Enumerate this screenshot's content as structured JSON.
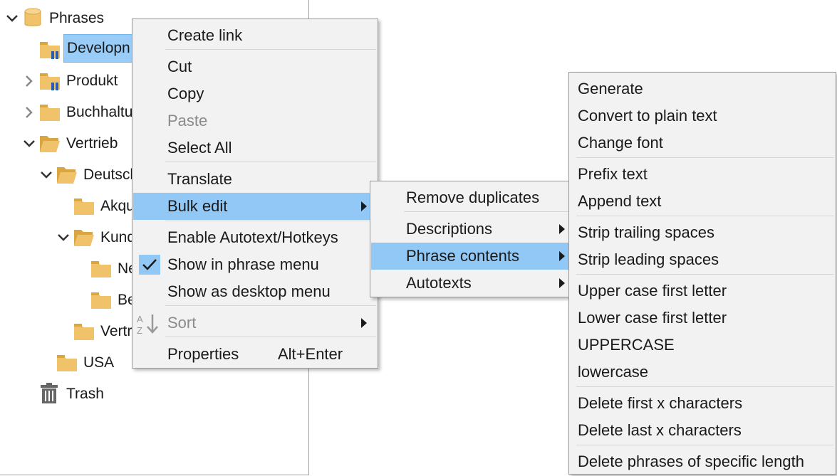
{
  "tree": {
    "items": [
      {
        "label": "Phrases",
        "icon": "database-icon"
      },
      {
        "label": "Developn",
        "icon": "folder-shared-icon"
      },
      {
        "label": "Produkt",
        "icon": "folder-shared-icon"
      },
      {
        "label": "Buchhaltu",
        "icon": "folder-icon"
      },
      {
        "label": "Vertrieb",
        "icon": "folder-open-icon"
      },
      {
        "label": "Deutsch",
        "icon": "folder-open-icon"
      },
      {
        "label": "Akqu",
        "icon": "folder-icon"
      },
      {
        "label": "Kund",
        "icon": "folder-open-icon"
      },
      {
        "label": "Ne",
        "icon": "folder-icon"
      },
      {
        "label": "Be",
        "icon": "folder-icon"
      },
      {
        "label": "Vertr",
        "icon": "folder-icon"
      },
      {
        "label": "USA",
        "icon": "folder-icon"
      },
      {
        "label": "Trash",
        "icon": "trash-icon"
      }
    ]
  },
  "context_menu": {
    "create_link": "Create link",
    "cut": "Cut",
    "copy": "Copy",
    "paste": "Paste",
    "select_all": "Select All",
    "translate": "Translate",
    "bulk_edit": "Bulk edit",
    "enable_autotext": "Enable Autotext/Hotkeys",
    "show_in_phrase_menu": "Show in phrase menu",
    "show_as_desktop_menu": "Show as desktop menu",
    "sort": "Sort",
    "properties": "Properties",
    "properties_shortcut": "Alt+Enter"
  },
  "bulk_menu": {
    "remove_duplicates": "Remove duplicates",
    "descriptions": "Descriptions",
    "phrase_contents": "Phrase contents",
    "autotexts": "Autotexts"
  },
  "phrase_menu": {
    "generate": "Generate",
    "convert_plain": "Convert to plain text",
    "change_font": "Change font",
    "prefix_text": "Prefix text",
    "append_text": "Append text",
    "strip_trailing": "Strip trailing spaces",
    "strip_leading": "Strip leading spaces",
    "upper_first": "Upper case first letter",
    "lower_first": "Lower case first letter",
    "uppercase": "UPPERCASE",
    "lowercase": "lowercase",
    "delete_first": "Delete first x characters",
    "delete_last": "Delete last x characters",
    "delete_length": "Delete phrases of specific length"
  },
  "colors": {
    "highlight": "#92c8f6",
    "selection": "#99cdf7",
    "folder": "#f0c26a",
    "menu_bg": "#f2f2f2",
    "shared_badge": "#2a5db0"
  }
}
